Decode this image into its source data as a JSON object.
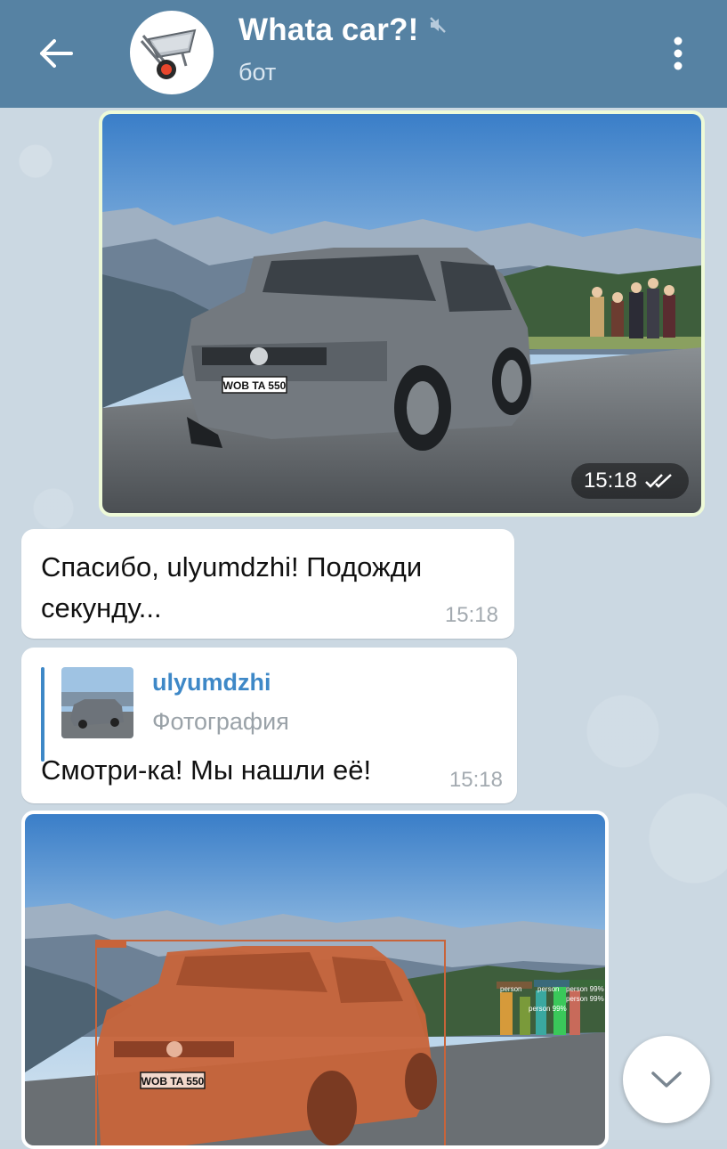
{
  "header": {
    "title": "Whata car?!",
    "subtitle": "бот",
    "back_icon": "arrow-left-icon",
    "mute_icon": "muted-speaker-icon",
    "menu_icon": "more-vertical-icon",
    "avatar_icon": "wheelbarrow-icon"
  },
  "messages": [
    {
      "type": "photo",
      "direction": "outgoing",
      "plate": "WOB TA 550",
      "time": "15:18",
      "status_icon": "double-check-icon"
    },
    {
      "type": "text",
      "direction": "incoming",
      "text": "Спасибо, ulyumdzhi! Подожди секунду...",
      "time": "15:18"
    },
    {
      "type": "reply",
      "direction": "incoming",
      "reply_author": "ulyumdzhi",
      "reply_caption": "Фотография",
      "text": "Смотри-ка! Мы нашли её!",
      "time": "15:18"
    },
    {
      "type": "photo",
      "direction": "incoming",
      "plate": "WOB TA 550",
      "detections": [
        "person",
        "person 99%",
        "person",
        "person 99%",
        "person 99%"
      ]
    }
  ],
  "colors": {
    "header_bg": "#5682a3",
    "outgoing_border": "#eefad8",
    "accent": "#3e88c7",
    "segmentation_car": "#c8643a"
  },
  "fab": {
    "icon": "chevron-down-icon"
  }
}
